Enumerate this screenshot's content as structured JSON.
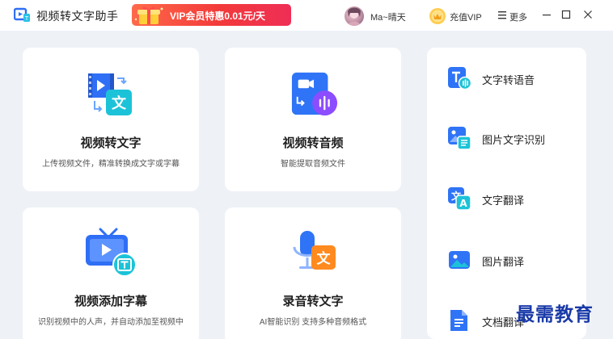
{
  "app": {
    "title": "视频转文字助手"
  },
  "promo": {
    "text": "VIP会员特惠0.01元/天"
  },
  "user": {
    "name": "Ma~晴天"
  },
  "header": {
    "vip_label": "充值VIP",
    "more_label": "更多"
  },
  "cards": [
    {
      "title": "视频转文字",
      "desc": "上传视频文件，精准转换成文字或字幕"
    },
    {
      "title": "视频转音频",
      "desc": "智能提取音频文件"
    },
    {
      "title": "视频添加字幕",
      "desc": "识别视频中的人声，并自动添加至视频中"
    },
    {
      "title": "录音转文字",
      "desc": "AI智能识别 支持多种音频格式"
    }
  ],
  "sidebar": {
    "items": [
      {
        "label": "文字转语音",
        "icon": "text-to-speech-icon"
      },
      {
        "label": "图片文字识别",
        "icon": "image-ocr-icon"
      },
      {
        "label": "文字翻译",
        "icon": "text-translate-icon"
      },
      {
        "label": "图片翻译",
        "icon": "image-translate-icon"
      },
      {
        "label": "文档翻译",
        "icon": "document-translate-icon"
      }
    ]
  },
  "watermark": "最需教育",
  "colors": {
    "accent_blue": "#2f7bf5",
    "accent_cyan": "#26c6da",
    "promo_red": "#f23a3a",
    "orange": "#ff8a1f",
    "purple": "#8a4dff"
  }
}
